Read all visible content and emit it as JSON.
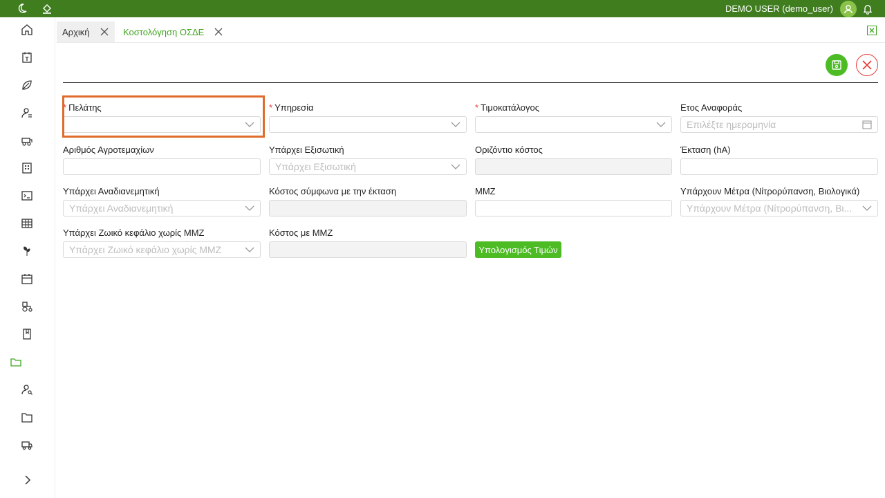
{
  "topbar": {
    "user_label": "DEMO USER (demo_user)"
  },
  "tabs": [
    {
      "label": "Αρχική",
      "active": false
    },
    {
      "label": "Κοστολόγηση ΟΣΔΕ",
      "active": true
    }
  ],
  "form": {
    "fields": {
      "client": {
        "label": "Πελάτης",
        "required": true,
        "placeholder": ""
      },
      "service": {
        "label": "Υπηρεσία",
        "required": true,
        "placeholder": ""
      },
      "pricelist": {
        "label": "Τιμοκατάλογος",
        "required": true,
        "placeholder": ""
      },
      "ref_year": {
        "label": "Ετος Αναφοράς",
        "placeholder": "Επιλέξτε ημερομηνία"
      },
      "parcels": {
        "label": "Αριθμός Αγροτεμαχίων",
        "value": ""
      },
      "leveling": {
        "label": "Υπάρχει Εξισωτική",
        "placeholder": "Υπάρχει Εξισωτική"
      },
      "horizontal_cost": {
        "label": "Οριζόντιο κόστος",
        "value": ""
      },
      "area": {
        "label": "Έκταση (hA)",
        "value": ""
      },
      "redistributive": {
        "label": "Υπάρχει Αναδιανεμητική",
        "placeholder": "Υπάρχει Αναδιανεμητική"
      },
      "cost_by_area": {
        "label": "Κόστος σύμφωνα με την έκταση",
        "value": ""
      },
      "mmz": {
        "label": "ΜΜΖ",
        "value": ""
      },
      "measures": {
        "label": "Υπάρχουν Μέτρα (Νίτρορύπανση, Βιολογικά)",
        "placeholder": "Υπάρχουν Μέτρα (Νίτρορύπανση, Βι..."
      },
      "livestock": {
        "label": "Υπάρχει Ζωικό κεφάλιο χωρίς ΜΜΖ",
        "placeholder": "Υπάρχει Ζωικό κεφάλιο χωρίς ΜΜΖ"
      },
      "cost_mmz": {
        "label": "Κόστος με ΜΜΖ",
        "value": ""
      }
    },
    "calc_button_label": "Υπολογισμός Τιμών"
  },
  "colors": {
    "topbar": "#3f7d1f",
    "accent": "#4cbb24",
    "required": "#e53935",
    "highlight": "#e06b2a"
  },
  "sidebar_icons": [
    "home-icon",
    "invoice-icon",
    "leaf-icon",
    "user-list-icon",
    "tractor-icon",
    "building-icon",
    "terminal-icon",
    "table-icon",
    "plant-icon",
    "calendar-icon",
    "tractor-2-icon",
    "book-icon",
    "folder-open-icon",
    "user-search-icon",
    "folder-icon",
    "truck-icon",
    "expand-icon"
  ]
}
